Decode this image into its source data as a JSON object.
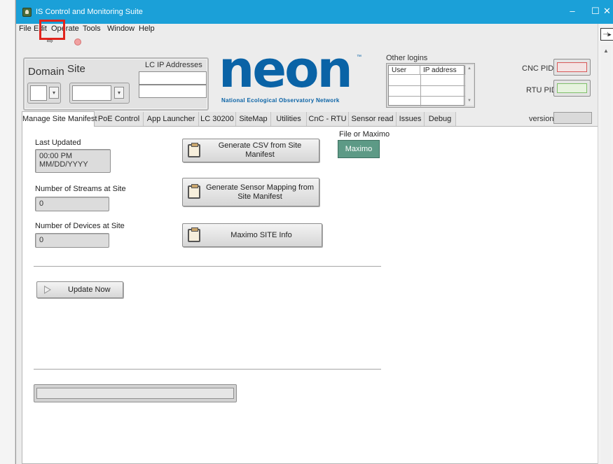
{
  "window": {
    "title": "IS Control and Monitoring Suite",
    "controls": {
      "minimize": "–",
      "maximize": "☐",
      "close": "✕"
    }
  },
  "menu": [
    "File",
    "Edit",
    "Operate",
    "Tools",
    "Window",
    "Help"
  ],
  "toolbar": {
    "run_icon": "⇨",
    "run": "run-arrow-icon",
    "stop": "abort-icon"
  },
  "header": {
    "domain_label": "Domain",
    "site_label": "Site",
    "lc_ip_label": "LC IP Addresses",
    "logo_text": "neon",
    "logo_tm": "™",
    "logo_subtitle": "National Ecological Observatory Network",
    "other_logins_label": "Other logins",
    "logins_columns": [
      "User",
      "IP address"
    ],
    "cnc_pid_label": "CNC PID",
    "rtu_pid_label": "RTU PID",
    "version_label": "version",
    "colors": {
      "cnc_led": "#e06a6a",
      "rtu_led": "#9fd18b",
      "logo": "#0a63a6"
    }
  },
  "tabs": [
    "Manage Site Manifest",
    "PoE Control",
    "App Launcher",
    "LC 30200",
    "SiteMap",
    "Utilities",
    "CnC - RTU",
    "Sensor read",
    "Issues",
    "Debug"
  ],
  "active_tab": "Manage Site Manifest",
  "manifest": {
    "last_updated_label": "Last Updated",
    "last_updated_time": "00:00 PM",
    "last_updated_date": "MM/DD/YYYY",
    "streams_label": "Number of Streams at Site",
    "streams_value": "0",
    "devices_label": "Number of Devices at Site",
    "devices_value": "0",
    "generate_csv_label": "Generate CSV from Site Manifest",
    "generate_mapping_label": "Generate Sensor Mapping from Site Manifest",
    "maximo_site_info_label": "Maximo SITE Info",
    "file_or_maximo_label": "File or Maximo",
    "maximo_button_label": "Maximo",
    "update_now_label": "Update Now",
    "progress_fraction": 0
  }
}
